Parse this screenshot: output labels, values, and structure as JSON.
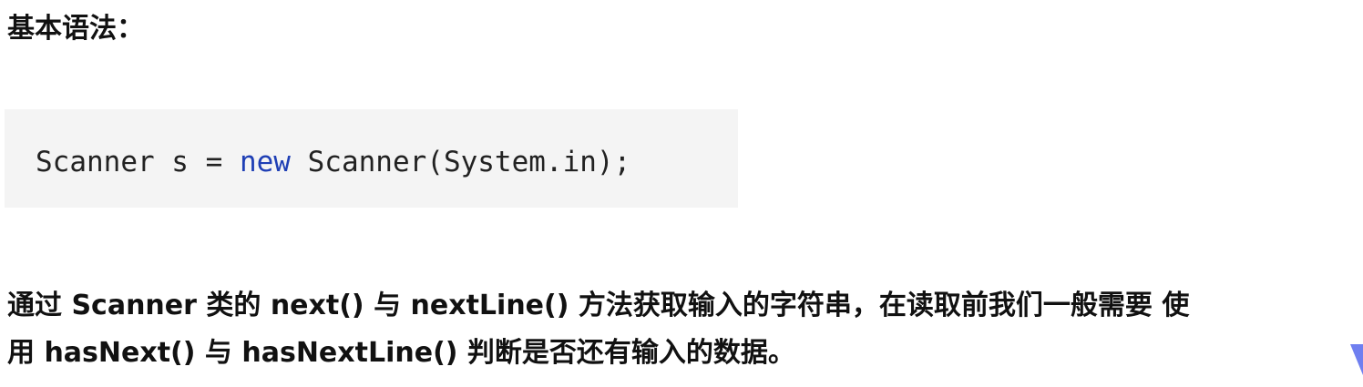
{
  "heading": "基本语法：",
  "code": {
    "before_keyword": "Scanner s = ",
    "keyword": "new",
    "after_keyword": " Scanner(System.in);"
  },
  "paragraph": {
    "line1": "通过 Scanner 类的 next() 与 nextLine() 方法获取输入的字符串，在读取前我们一般需要 使",
    "line2": "用 hasNext() 与 hasNextLine() 判断是否还有输入的数据。"
  },
  "colors": {
    "code_background": "#f4f4f4",
    "keyword": "#1f3fb5",
    "corner_mark": "#6f7ff0"
  }
}
